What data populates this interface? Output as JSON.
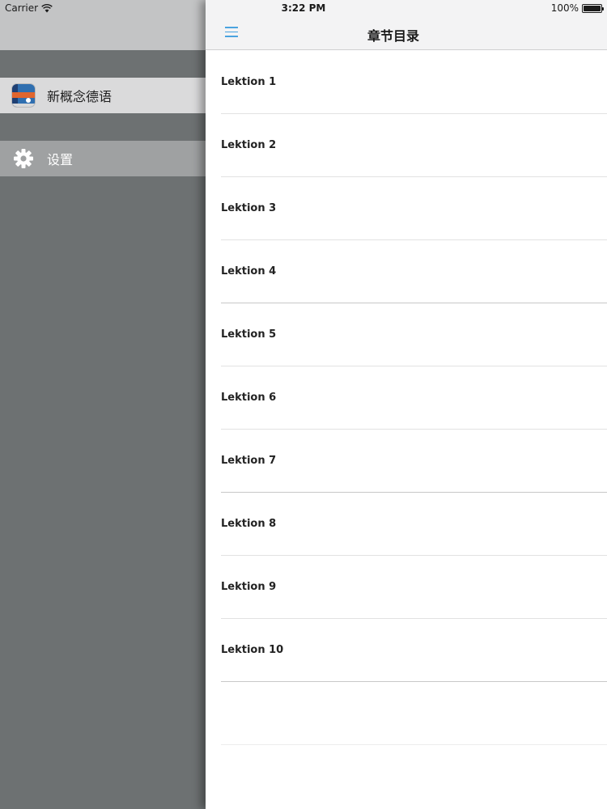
{
  "status_bar": {
    "carrier": "Carrier",
    "time": "3:22 PM",
    "battery": "100%",
    "battery_level": 1.0
  },
  "side_menu": {
    "items": [
      {
        "label": "新概念德语",
        "icon": "book-app-icon"
      },
      {
        "label": "设置",
        "icon": "gear-icon"
      }
    ]
  },
  "nav": {
    "title": "章节目录",
    "menu_icon": "hamburger-menu-icon",
    "accent_color": "#4aa3df"
  },
  "lessons": [
    "Lektion 1",
    "Lektion 2",
    "Lektion 3",
    "Lektion 4",
    "Lektion 5",
    "Lektion 6",
    "Lektion 7",
    "Lektion 8",
    "Lektion 9",
    "Lektion 10"
  ]
}
